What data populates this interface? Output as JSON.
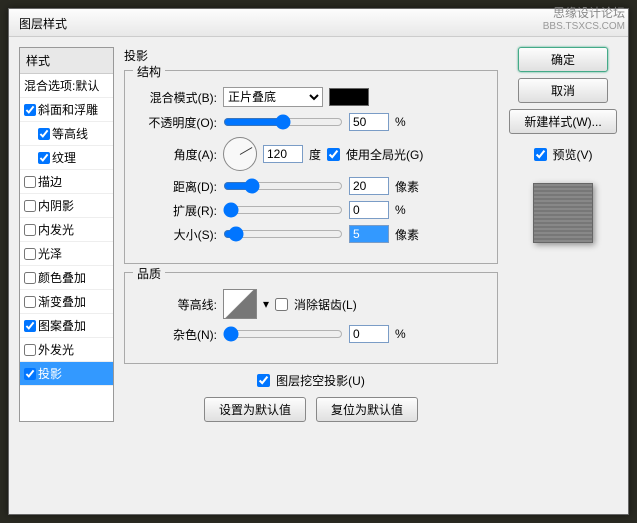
{
  "watermark": {
    "line1": "思缘设计论坛",
    "line2": "BBS.TSXCS.COM"
  },
  "title": "图层样式",
  "sidebar": {
    "header": "样式",
    "items": [
      {
        "label": "混合选项:默认",
        "checked": null,
        "indent": false
      },
      {
        "label": "斜面和浮雕",
        "checked": true,
        "indent": false
      },
      {
        "label": "等高线",
        "checked": true,
        "indent": true
      },
      {
        "label": "纹理",
        "checked": true,
        "indent": true
      },
      {
        "label": "描边",
        "checked": false,
        "indent": false
      },
      {
        "label": "内阴影",
        "checked": false,
        "indent": false
      },
      {
        "label": "内发光",
        "checked": false,
        "indent": false
      },
      {
        "label": "光泽",
        "checked": false,
        "indent": false
      },
      {
        "label": "颜色叠加",
        "checked": false,
        "indent": false
      },
      {
        "label": "渐变叠加",
        "checked": false,
        "indent": false
      },
      {
        "label": "图案叠加",
        "checked": true,
        "indent": false
      },
      {
        "label": "外发光",
        "checked": false,
        "indent": false
      },
      {
        "label": "投影",
        "checked": true,
        "indent": false,
        "selected": true
      }
    ]
  },
  "main": {
    "heading": "投影",
    "structure": {
      "title": "结构",
      "blend_label": "混合模式(B):",
      "blend_value": "正片叠底",
      "opacity_label": "不透明度(O):",
      "opacity_value": "50",
      "opacity_unit": "%",
      "angle_label": "角度(A):",
      "angle_value": "120",
      "angle_unit": "度",
      "global_light_label": "使用全局光(G)",
      "global_light_checked": true,
      "distance_label": "距离(D):",
      "distance_value": "20",
      "distance_unit": "像素",
      "spread_label": "扩展(R):",
      "spread_value": "0",
      "spread_unit": "%",
      "size_label": "大小(S):",
      "size_value": "5",
      "size_unit": "像素"
    },
    "quality": {
      "title": "品质",
      "contour_label": "等高线:",
      "antialias_label": "消除锯齿(L)",
      "antialias_checked": false,
      "noise_label": "杂色(N):",
      "noise_value": "0",
      "noise_unit": "%"
    },
    "knockout_label": "图层挖空投影(U)",
    "knockout_checked": true,
    "default_btn": "设置为默认值",
    "reset_btn": "复位为默认值"
  },
  "buttons": {
    "ok": "确定",
    "cancel": "取消",
    "new_style": "新建样式(W)...",
    "preview_label": "预览(V)",
    "preview_checked": true
  }
}
